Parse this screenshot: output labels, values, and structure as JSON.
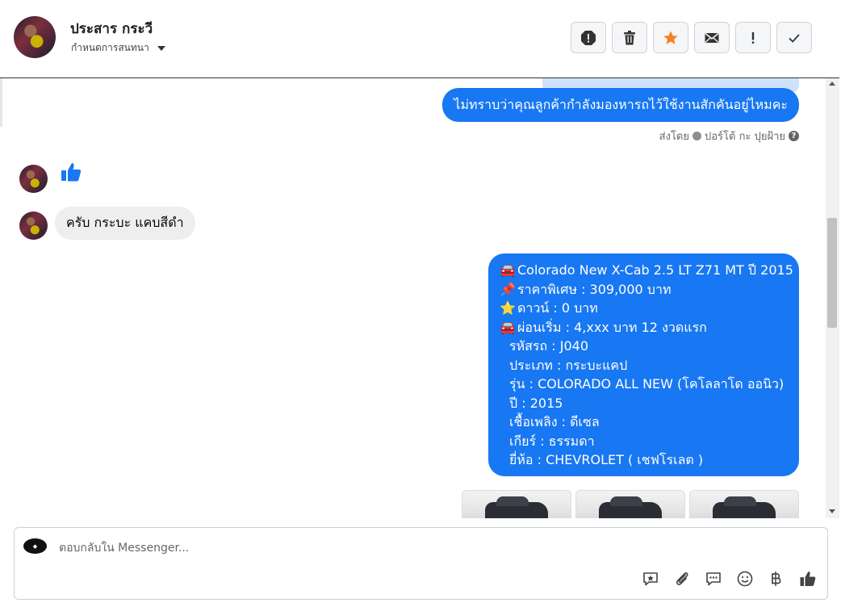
{
  "header": {
    "contact_name": "ประสาร กระวี",
    "assign_label": "กำหนดการสนทนา"
  },
  "toolbar": [
    {
      "name": "spam",
      "icon": "alert-octagon-icon"
    },
    {
      "name": "delete",
      "icon": "trash-icon"
    },
    {
      "name": "star",
      "icon": "star-icon",
      "color": "#f5821f"
    },
    {
      "name": "mark-unread",
      "icon": "envelope-icon"
    },
    {
      "name": "follow-up",
      "icon": "exclamation-icon"
    },
    {
      "name": "done",
      "icon": "check-icon"
    }
  ],
  "messages": {
    "question": "ไม่ทราบว่าคุณลูกค้ากำลังมองหารถไว้ใช้งานสักคันอยู่ไหมคะ",
    "sent_by_prefix": "ส่งโดย",
    "sent_by_name": "ปอร์โต้ กะ ปุยฝ้าย",
    "reply_text": "ครับ กระบะ แคบสีดำ",
    "car_lines": [
      {
        "icon": "🚘",
        "text": "Colorado New X-Cab 2.5 LT Z71 MT ปี 2015"
      },
      {
        "icon": "📌",
        "text": "ราคาพิเศษ : 309,000 บาท"
      },
      {
        "icon": "⭐",
        "text": "ดาวน์ : 0 บาท"
      },
      {
        "icon": "🚘",
        "text": "ผ่อนเริ่ม : 4,xxx บาท 12 งวดแรก"
      },
      {
        "icon": "",
        "text": "รหัสรถ : J040"
      },
      {
        "icon": "",
        "text": "ประเภท : กระบะแคป"
      },
      {
        "icon": "",
        "text": "รุ่น : COLORADO ALL NEW (โคโลลาโด ออนิว)"
      },
      {
        "icon": "",
        "text": "ปี : 2015"
      },
      {
        "icon": "",
        "text": "เชื้อเพลิง : ดีเซล"
      },
      {
        "icon": "",
        "text": "เกียร์ : ธรรมดา"
      },
      {
        "icon": "",
        "text": "ยี่ห้อ : CHEVROLET ( เชฟโรเลต )"
      }
    ]
  },
  "composer": {
    "placeholder": "ตอบกลับใน Messenger...",
    "tools": [
      "saved-reply-icon",
      "attachment-icon",
      "chat-bubble-icon",
      "emoji-icon",
      "baht-icon",
      "thumbs-up-icon"
    ]
  },
  "colors": {
    "accent": "#1877f2",
    "incoming_bubble": "#eeeeef",
    "star": "#f5821f"
  }
}
